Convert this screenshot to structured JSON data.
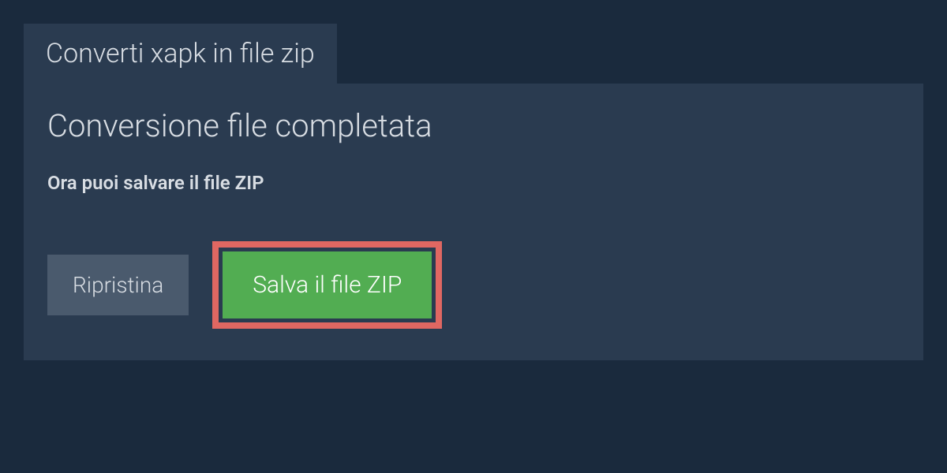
{
  "tab": {
    "label": "Converti xapk in file zip"
  },
  "panel": {
    "heading": "Conversione file completata",
    "subtext": "Ora puoi salvare il file ZIP"
  },
  "buttons": {
    "reset": "Ripristina",
    "save": "Salva il file ZIP"
  }
}
